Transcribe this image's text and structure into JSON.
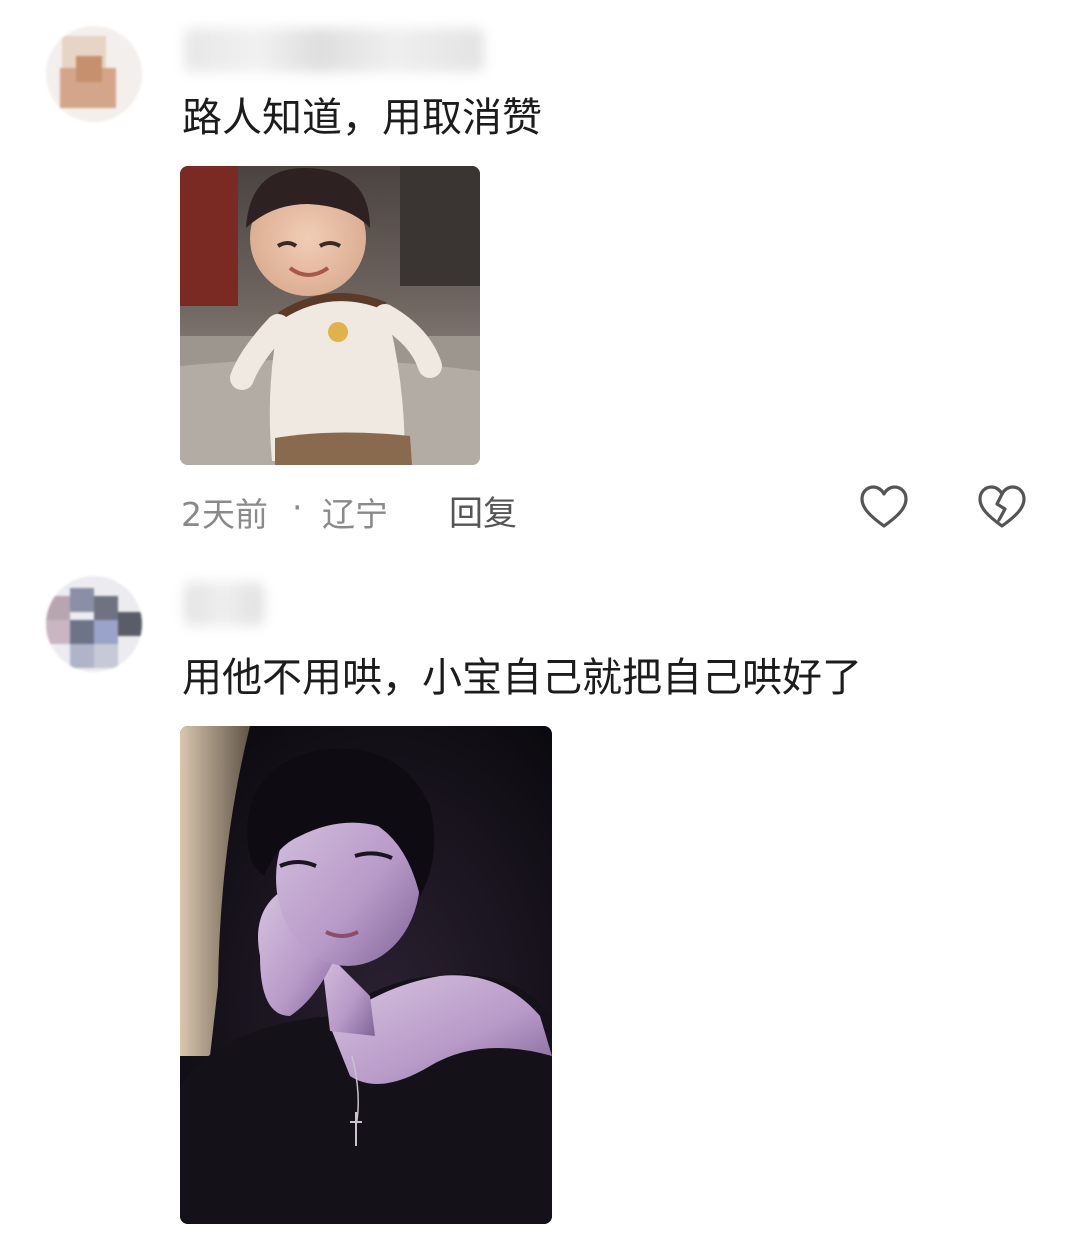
{
  "comments": [
    {
      "text": "路人知道，用取消赞",
      "timestamp": "2天前",
      "separator": "·",
      "location": "辽宁",
      "reply_label": "回复",
      "image": "toddler-meme"
    },
    {
      "text": "用他不用哄，小宝自己就把自己哄好了",
      "image": "portrait-photo"
    }
  ],
  "icons": {
    "like": "heart-outline-icon",
    "dislike": "broken-heart-icon"
  },
  "colors": {
    "meta": "#8a8a8a",
    "reply": "#555555",
    "icon_stroke": "#555555"
  }
}
